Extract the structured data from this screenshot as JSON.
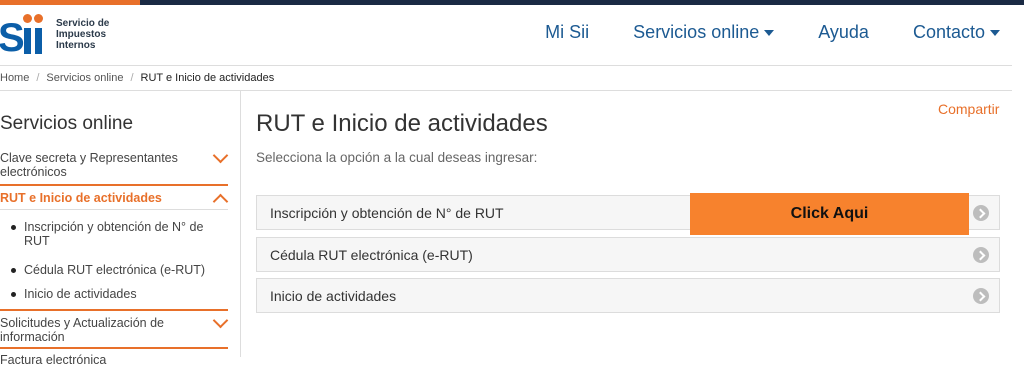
{
  "brand": {
    "name_line1": "Servicio de",
    "name_line2": "Impuestos",
    "name_line3": "Internos"
  },
  "nav": [
    {
      "label": "Mi Sii",
      "dropdown": false
    },
    {
      "label": "Servicios online",
      "dropdown": true
    },
    {
      "label": "Ayuda",
      "dropdown": false
    },
    {
      "label": "Contacto",
      "dropdown": true
    }
  ],
  "breadcrumb": {
    "home": "Home",
    "level1": "Servicios online",
    "current": "RUT e Inicio de actividades"
  },
  "sidebar": {
    "title": "Servicios online",
    "sections": [
      {
        "label": "Clave secreta y Representantes electrónicos",
        "expanded": false
      },
      {
        "label": "RUT e Inicio de actividades",
        "expanded": true
      },
      {
        "label": "Solicitudes y Actualización de información",
        "expanded": false
      },
      {
        "label": "Factura electrónica",
        "expanded": false
      }
    ],
    "sub_items": [
      "Inscripción y obtención de N° de RUT",
      "Cédula RUT electrónica (e-RUT)",
      "Inicio de actividades"
    ]
  },
  "main": {
    "title": "RUT e Inicio de actividades",
    "subtitle": "Selecciona la opción a la cual deseas ingresar:",
    "share": "Compartir",
    "options": [
      "Inscripción y obtención de N° de RUT",
      "Cédula RUT electrónica (e-RUT)",
      "Inicio de actividades"
    ]
  },
  "overlay": {
    "label": "Click Aqui"
  },
  "colors": {
    "accent": "#e8702a",
    "brand_blue": "#0b5ea8",
    "nav_blue": "#1c5a92",
    "overlay": "#f7822d",
    "topbar": "#1a2a44"
  },
  "icons": [
    "sii-logo",
    "chevron-down-icon",
    "chevron-up-icon",
    "arrow-right-circle-icon",
    "bullet-icon",
    "caret-down-icon"
  ]
}
